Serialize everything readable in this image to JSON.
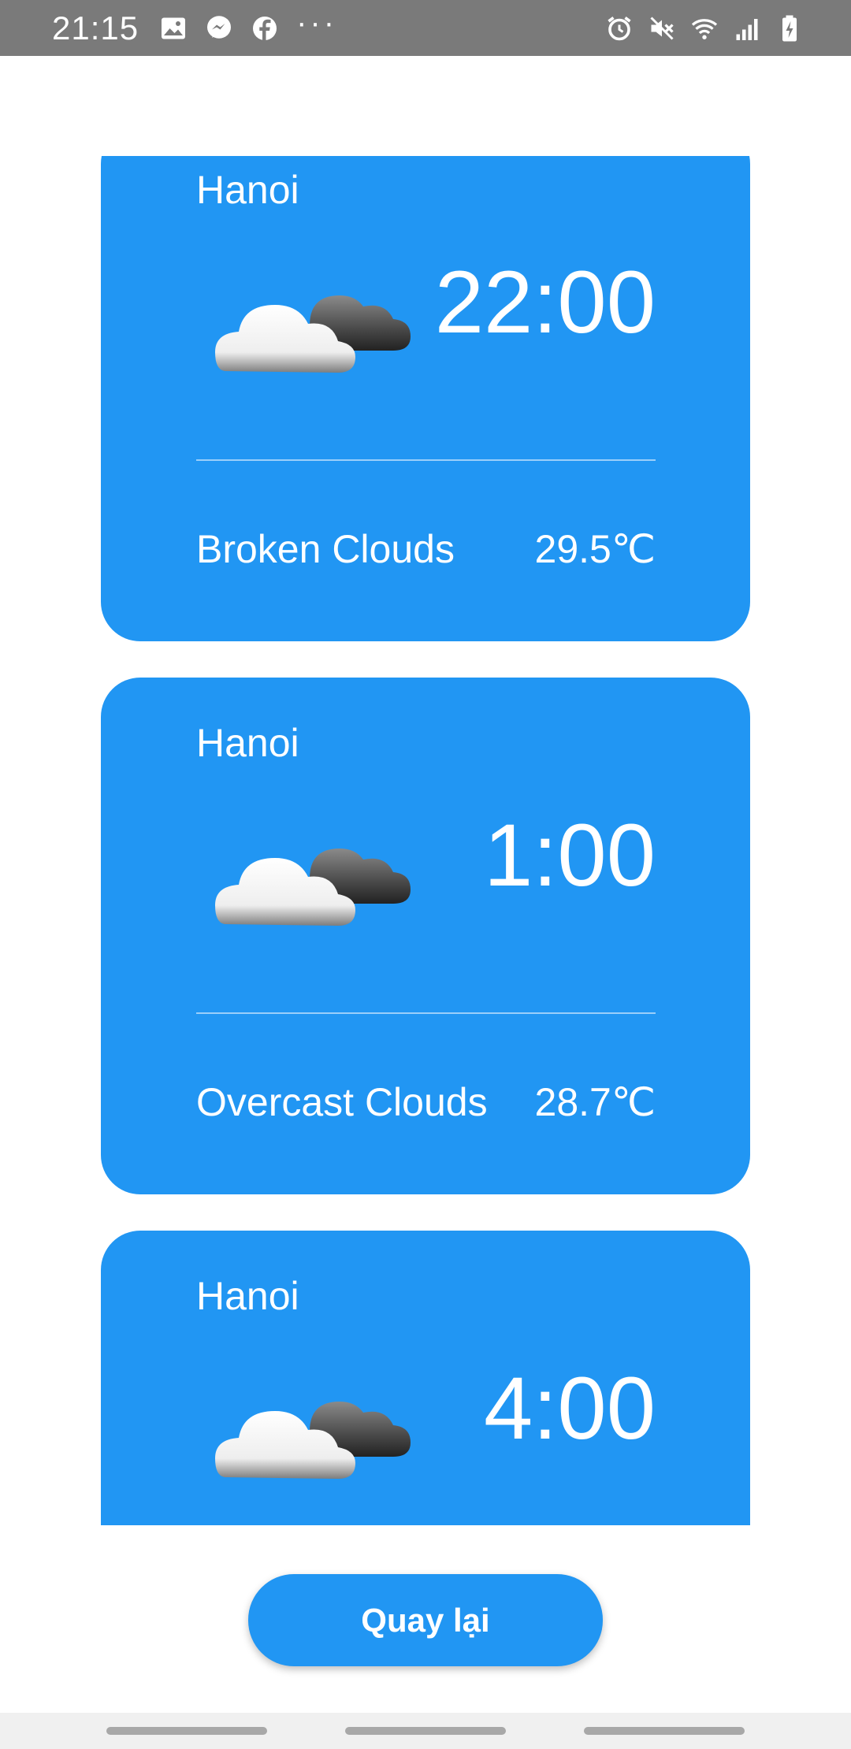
{
  "status_bar": {
    "time": "21:15",
    "left_icons": [
      "gallery-icon",
      "messenger-icon",
      "facebook-icon",
      "more-dots-icon"
    ],
    "more_dots": "···",
    "right_icons": [
      "alarm-icon",
      "mute-icon",
      "wifi-icon",
      "signal-icon",
      "battery-charging-icon"
    ]
  },
  "forecast": [
    {
      "city": "Hanoi",
      "time": "22:00",
      "description": "Broken Clouds",
      "temperature": "29.5℃",
      "icon": "broken-clouds-icon"
    },
    {
      "city": "Hanoi",
      "time": "1:00",
      "description": "Overcast Clouds",
      "temperature": "28.7℃",
      "icon": "overcast-clouds-icon"
    },
    {
      "city": "Hanoi",
      "time": "4:00",
      "description": "",
      "temperature": "",
      "icon": "overcast-clouds-icon"
    }
  ],
  "back_button": {
    "label": "Quay lại"
  },
  "colors": {
    "accent": "#2196f3",
    "status_bar": "#7a7a7a",
    "nav_bar": "#f0f0f0"
  }
}
